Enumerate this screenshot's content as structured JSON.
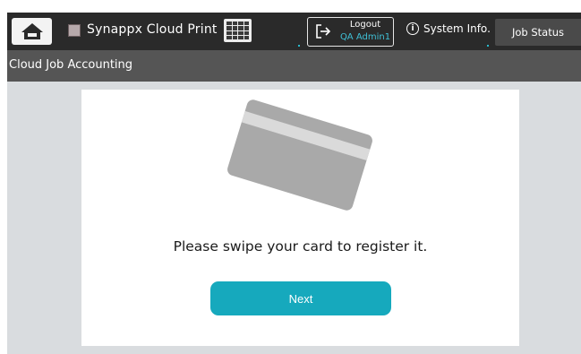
{
  "header": {
    "app_title": "Synappx Cloud Print",
    "logout": {
      "label": "Logout",
      "user": "QA Admin1"
    },
    "system_info_label": "System Info.",
    "job_status_label": "Job Status"
  },
  "subheader": {
    "title": "Cloud Job Accounting"
  },
  "main": {
    "prompt": "Please swipe your card to register it.",
    "next_label": "Next"
  },
  "icons": {
    "home": "home-icon",
    "app": "app-icon",
    "keyboard": "keyboard-icon",
    "logout": "logout-icon",
    "info": "info-icon",
    "card": "card-icon"
  },
  "colors": {
    "topbar": "#2a2a2a",
    "subbar": "#555555",
    "background": "#d9dcdf",
    "accent": "#16a9bd",
    "user_text": "#3fc0d6",
    "card": "#a9a9a9"
  }
}
